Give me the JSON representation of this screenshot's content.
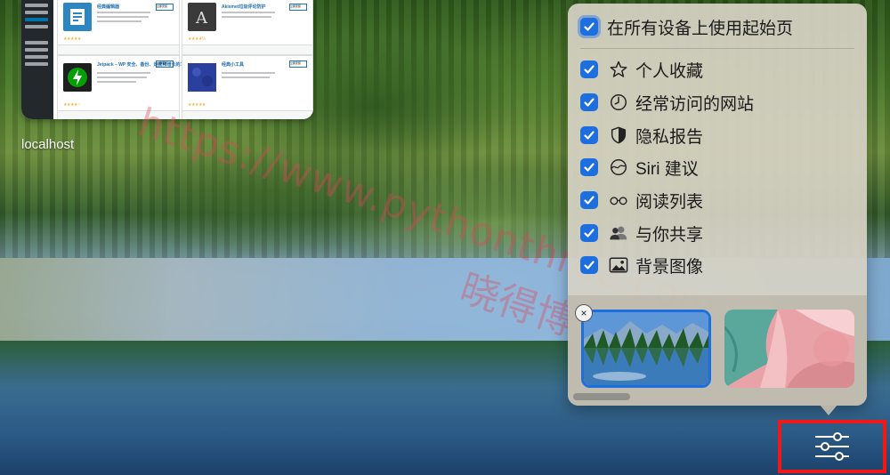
{
  "thumbnail": {
    "label": "localhost",
    "cards": [
      {
        "title": "经典编辑器",
        "button": "立即安装",
        "stars": "★★★★★"
      },
      {
        "title": "Akismet垃圾评论防护",
        "button": "立即安装",
        "stars": "★★★★½"
      },
      {
        "title": "Jetpack – WP 安全、备份、速度和增长的工具",
        "button": "立即安装",
        "stars": "★★★★☆"
      },
      {
        "title": "经典小工具",
        "button": "立即安装",
        "stars": "★★★★★"
      }
    ]
  },
  "watermark": {
    "url": "https://www.pythonthree.com",
    "name": "晓得博客"
  },
  "panel": {
    "master_toggle": {
      "label": "在所有设备上使用起始页",
      "checked": true
    },
    "items": [
      {
        "label": "个人收藏",
        "icon": "star-icon",
        "checked": true
      },
      {
        "label": "经常访问的网站",
        "icon": "clock-icon",
        "checked": true
      },
      {
        "label": "隐私报告",
        "icon": "shield-icon",
        "checked": true
      },
      {
        "label": "Siri 建议",
        "icon": "siri-icon",
        "checked": true
      },
      {
        "label": "阅读列表",
        "icon": "glasses-icon",
        "checked": true
      },
      {
        "label": "与你共享",
        "icon": "people-icon",
        "checked": true
      },
      {
        "label": "背景图像",
        "icon": "photo-icon",
        "checked": true
      }
    ],
    "backgrounds": [
      {
        "name": "lake-landscape",
        "selected": true
      },
      {
        "name": "butterfly",
        "selected": false
      }
    ],
    "close_symbol": "×"
  },
  "settings_button": {
    "icon": "sliders-icon"
  },
  "colors": {
    "accent": "#1d6fe0",
    "highlight_box": "#f01818"
  }
}
